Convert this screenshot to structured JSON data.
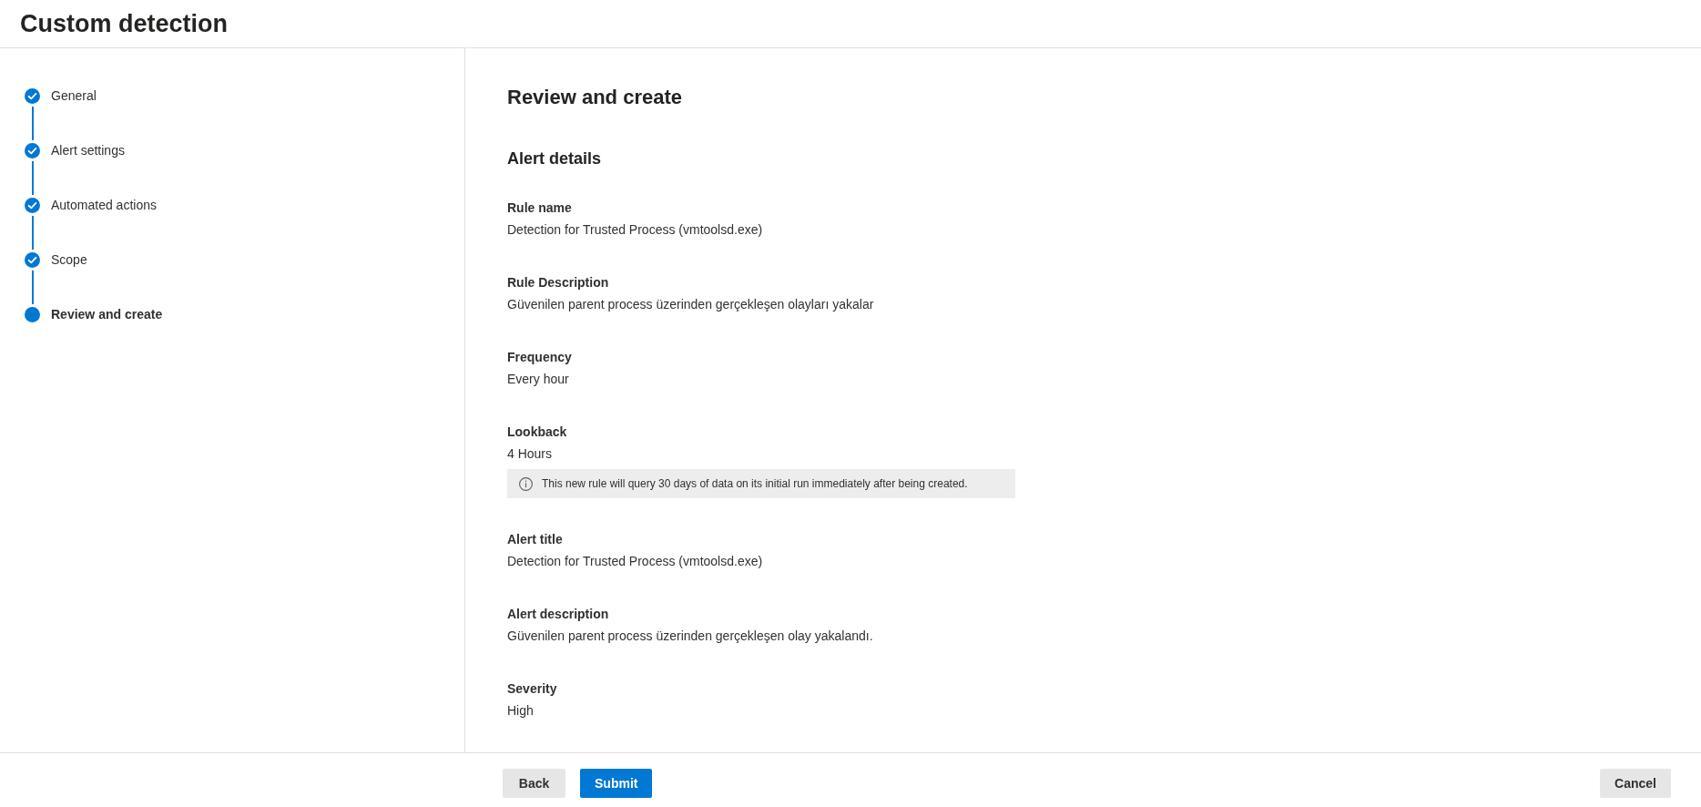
{
  "header": {
    "title": "Custom detection"
  },
  "steps": [
    {
      "label": "General",
      "completed": true,
      "selected": false
    },
    {
      "label": "Alert settings",
      "completed": true,
      "selected": false
    },
    {
      "label": "Automated actions",
      "completed": true,
      "selected": false
    },
    {
      "label": "Scope",
      "completed": true,
      "selected": false
    },
    {
      "label": "Review and create",
      "completed": false,
      "selected": true
    }
  ],
  "main": {
    "title": "Review and create",
    "section_title": "Alert details",
    "items": [
      {
        "kind": "field",
        "label": "Rule name",
        "value": "Detection for Trusted Process (vmtoolsd.exe)"
      },
      {
        "kind": "field",
        "label": "Rule Description",
        "value": "Güvenilen parent process üzerinden gerçekleşen olayları yakalar"
      },
      {
        "kind": "field",
        "label": "Frequency",
        "value": "Every hour"
      },
      {
        "kind": "field",
        "label": "Lookback",
        "value": "4 Hours"
      },
      {
        "kind": "notice",
        "text": "This new rule will query 30 days of data on its initial run immediately after being created."
      },
      {
        "kind": "field",
        "label": "Alert title",
        "value": "Detection for Trusted Process (vmtoolsd.exe)"
      },
      {
        "kind": "field",
        "label": "Alert description",
        "value": "Güvenilen parent process üzerinden gerçekleşen olay yakalandı."
      },
      {
        "kind": "field",
        "label": "Severity",
        "value": "High"
      }
    ]
  },
  "footer": {
    "buttons": [
      {
        "label": "Back",
        "kind": "secondary"
      },
      {
        "label": "Submit",
        "kind": "primary"
      }
    ],
    "cancel": {
      "label": "Cancel"
    }
  }
}
